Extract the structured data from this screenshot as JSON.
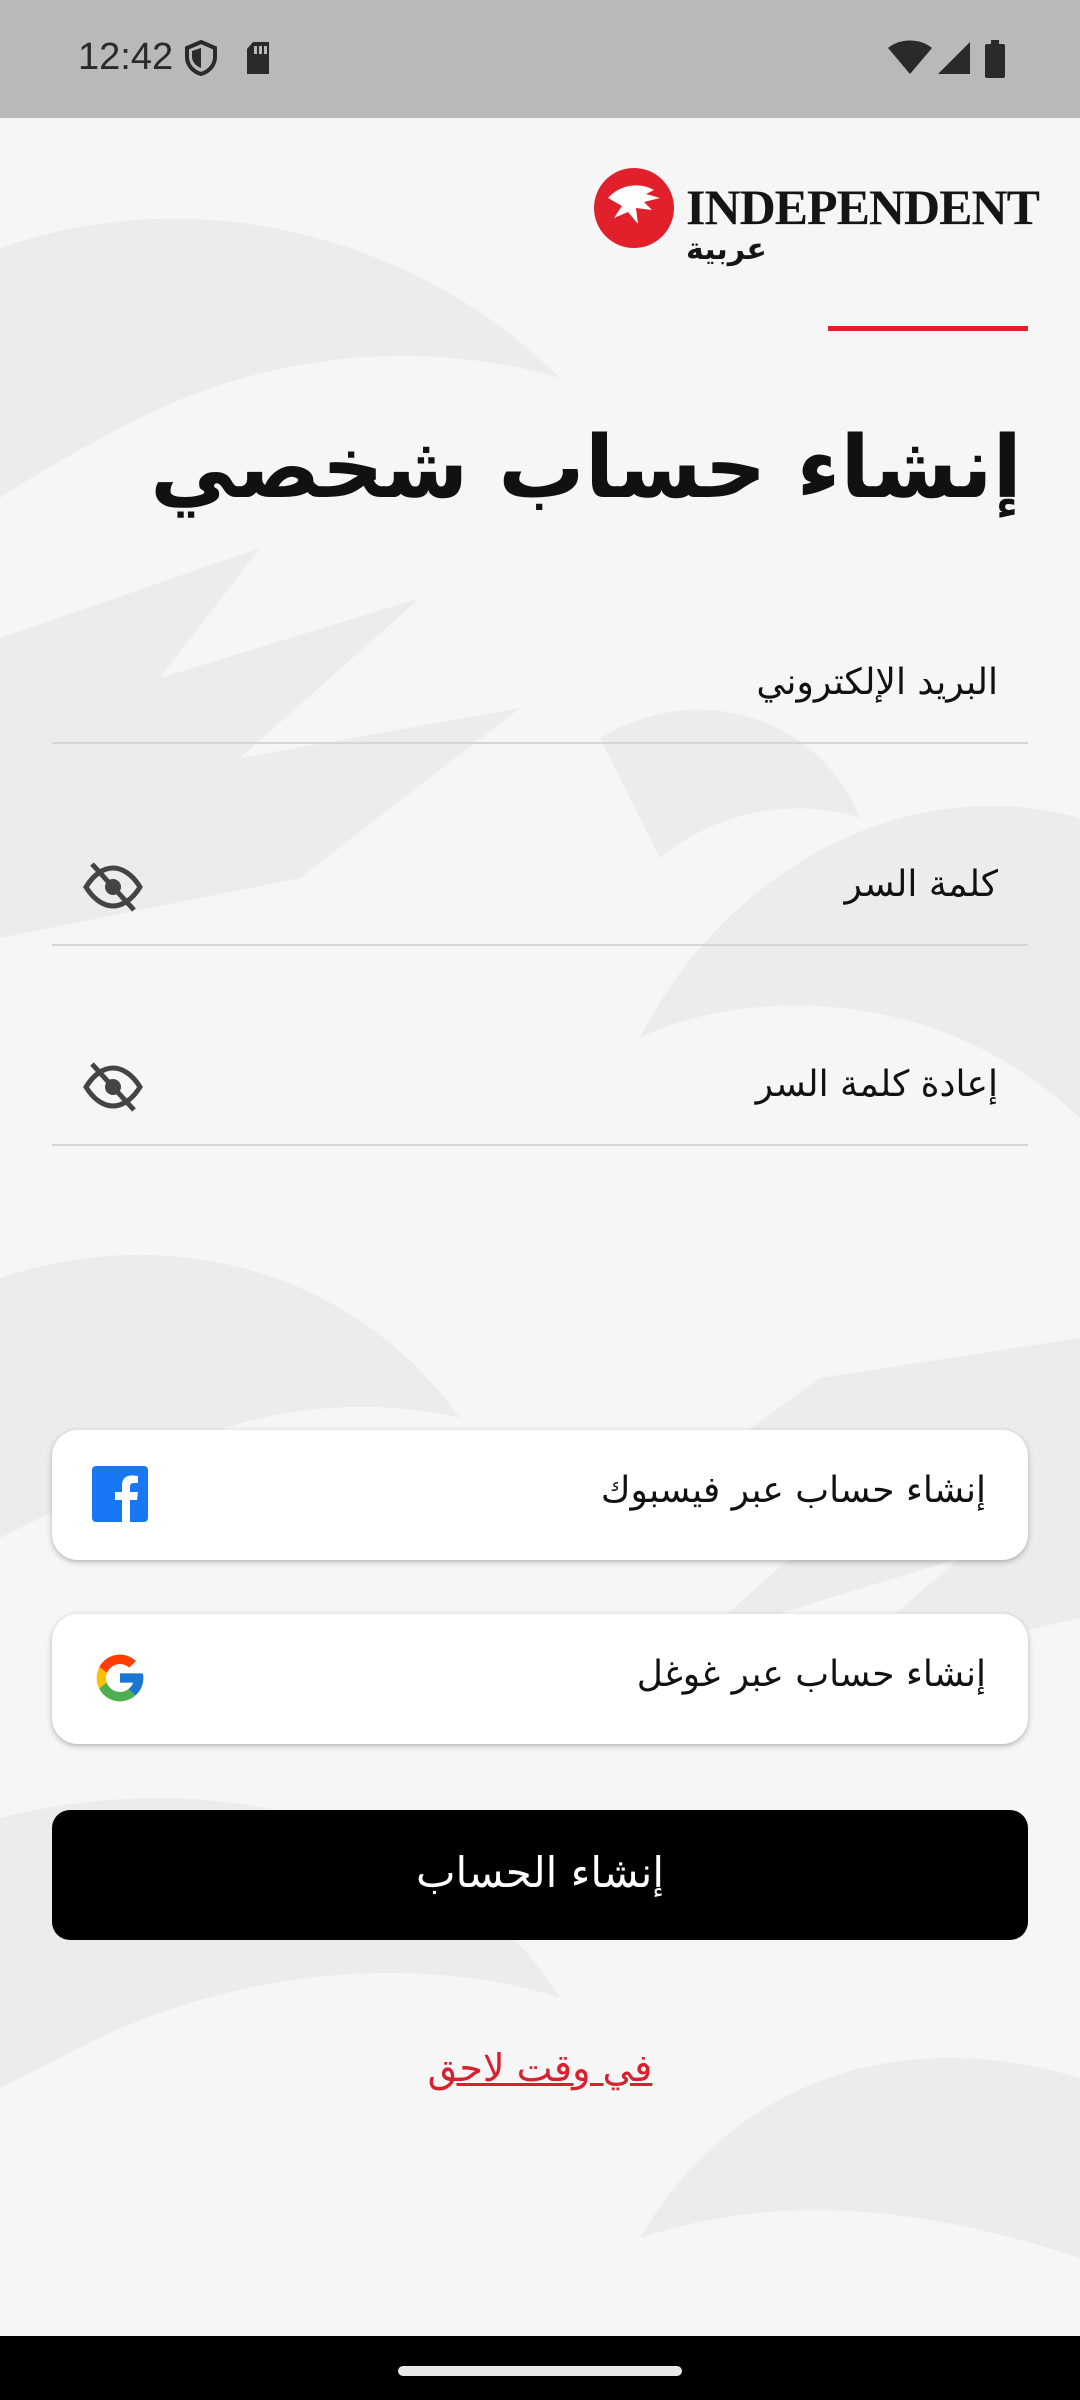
{
  "status_bar": {
    "time": "12:42",
    "icons": [
      "shield-icon",
      "sd-card-icon",
      "wifi-icon",
      "cell-signal-icon",
      "battery-icon"
    ]
  },
  "brand": {
    "name": "INDEPENDENT",
    "arabic_name": "عربية",
    "accent_color": "#e2202b"
  },
  "page_title": "إنشاء حساب شخصي",
  "form": {
    "email_placeholder": "البريد الإلكتروني",
    "password_placeholder": "كلمة السر",
    "confirm_password_placeholder": "إعادة كلمة السر",
    "email_value": "",
    "password_value": "",
    "confirm_password_value": ""
  },
  "social": {
    "facebook_label": "إنشاء حساب عبر فيسبوك",
    "google_label": "إنشاء حساب عبر غوغل",
    "facebook_color": "#1877f2"
  },
  "primary_button": {
    "label": "إنشاء الحساب"
  },
  "later_link": "في وقت لاحق",
  "link_color": "#d7212f"
}
